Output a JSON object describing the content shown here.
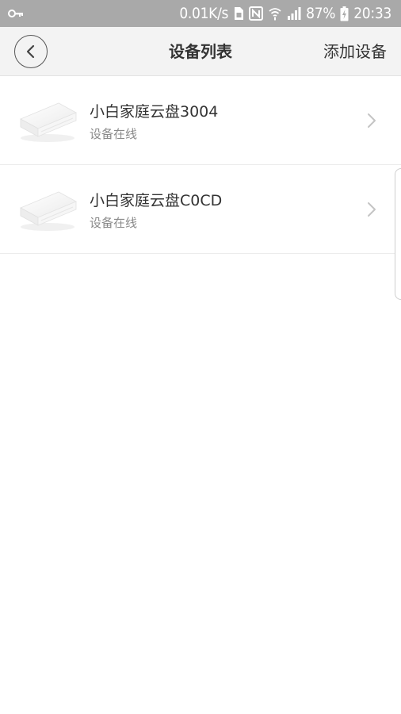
{
  "status_bar": {
    "net_speed": "0.01K/s",
    "battery": "87%",
    "time": "20:33",
    "icons": [
      "key-icon",
      "sim-icon",
      "nfc-icon",
      "wifi-icon",
      "signal-icon",
      "battery-charging-icon"
    ]
  },
  "header": {
    "title": "设备列表",
    "add_label": "添加设备",
    "back_icon": "chevron-left-icon"
  },
  "devices": [
    {
      "name": "小白家庭云盘3004",
      "status": "设备在线"
    },
    {
      "name": "小白家庭云盘C0CD",
      "status": "设备在线"
    }
  ],
  "colors": {
    "status_bar_bg": "#a9a9a9",
    "header_bg": "#f3f3f3",
    "title_text": "#333333",
    "secondary_text": "#8a8a8a",
    "divider": "#ececec"
  }
}
